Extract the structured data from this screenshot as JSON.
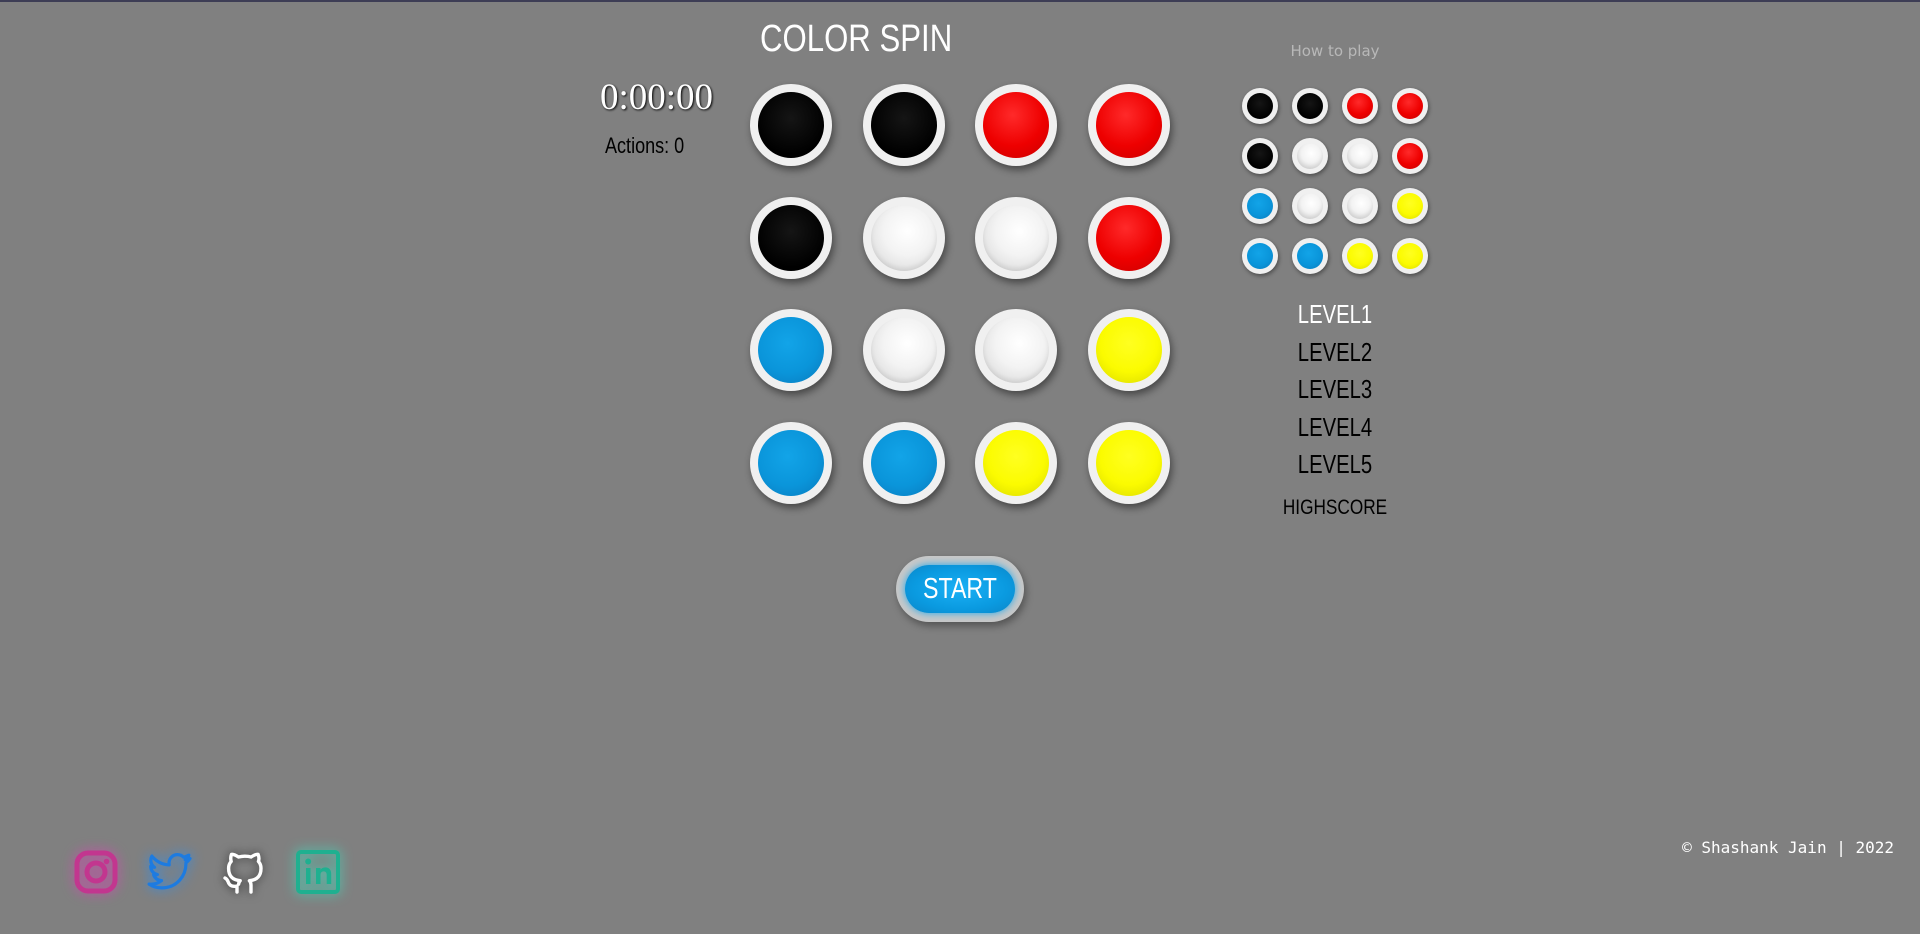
{
  "game": {
    "title": "COLOR SPIN",
    "timer": "0:00:00",
    "actions_text": "Actions: 0",
    "board": [
      [
        "black",
        "black",
        "red",
        "red"
      ],
      [
        "black",
        "white",
        "white",
        "red"
      ],
      [
        "blue",
        "white",
        "white",
        "yellow"
      ],
      [
        "blue",
        "blue",
        "yellow",
        "yellow"
      ]
    ],
    "start_label": "START"
  },
  "sidebar": {
    "how_to_play": "How to play",
    "target_board": [
      [
        "black",
        "black",
        "red",
        "red"
      ],
      [
        "black",
        "white",
        "white",
        "red"
      ],
      [
        "blue",
        "white",
        "white",
        "yellow"
      ],
      [
        "blue",
        "blue",
        "yellow",
        "yellow"
      ]
    ],
    "levels": [
      {
        "label": "LEVEL1",
        "active": true
      },
      {
        "label": "LEVEL2",
        "active": false
      },
      {
        "label": "LEVEL3",
        "active": false
      },
      {
        "label": "LEVEL4",
        "active": false
      },
      {
        "label": "LEVEL5",
        "active": false
      }
    ],
    "highscore": "HIGHSCORE"
  },
  "social": [
    {
      "name": "instagram-icon",
      "color": "#c2368f"
    },
    {
      "name": "twitter-icon",
      "color": "#1d7be0"
    },
    {
      "name": "github-icon",
      "color": "#ffffff"
    },
    {
      "name": "linkedin-icon",
      "color": "#1fb090"
    }
  ],
  "footer": {
    "copyright": "© Shashank Jain | 2022"
  },
  "colors": {
    "background": "#808080",
    "black": "#000000",
    "red": "#ee0000",
    "white": "#f0f0f0",
    "blue": "#0a95da",
    "yellow": "#fbfb00"
  }
}
